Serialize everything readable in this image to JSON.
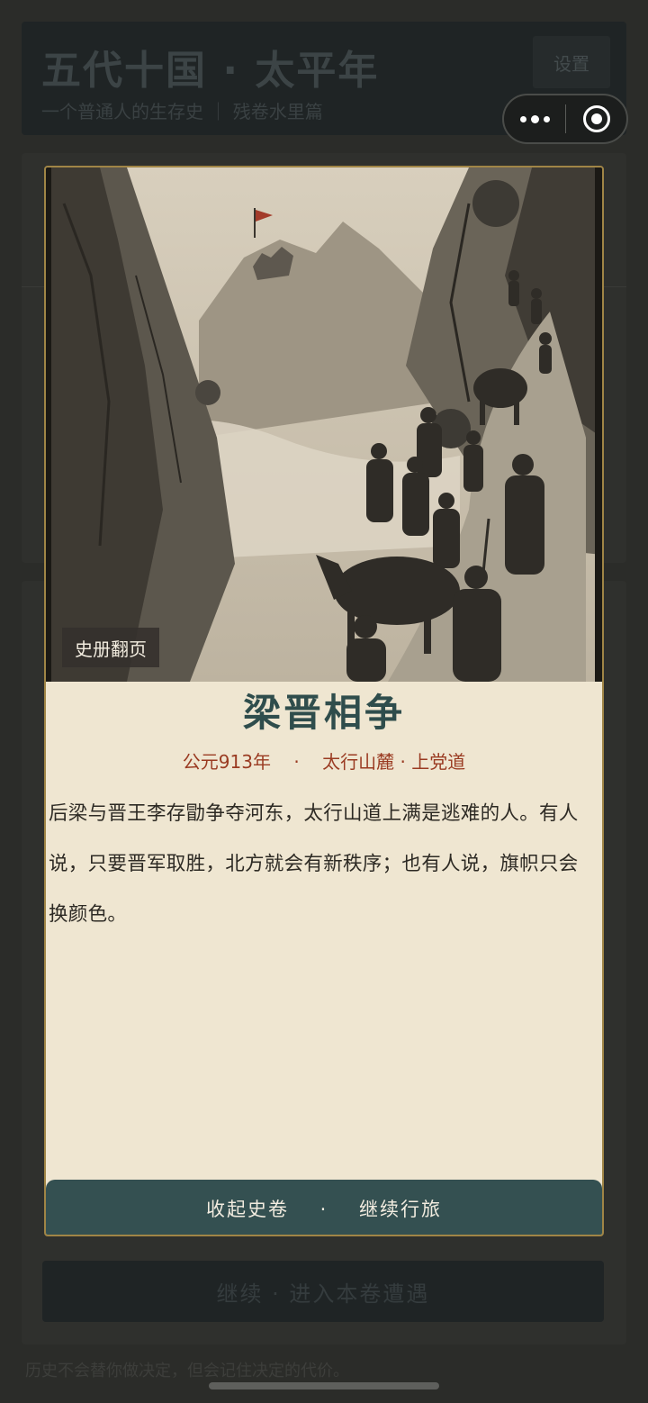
{
  "app": {
    "title": "五代十国 · 太平年",
    "subtitle": "一个普通人的生存史  ｜  残卷水里篇",
    "settings_label": "设置"
  },
  "capsule": {
    "more_icon": "more-dots-icon",
    "close_icon": "close-target-icon"
  },
  "modal": {
    "scene_tag": "史册翻页",
    "title": "梁晋相争",
    "meta": "公元913年    ·    太行山麓 · 上党道",
    "body": "后梁与晋王李存勖争夺河东，太行山道上满是逃难的人。有人说，只要晋军取胜，北方就会有新秩序；也有人说，旗帜只会换颜色。",
    "button_label": "收起史卷    ·    继续行旅"
  },
  "background": {
    "continue_label": "继续    ·    进入本卷遭遇",
    "footer_note": "历史不会替你做决定，但会记住决定的代价。"
  }
}
